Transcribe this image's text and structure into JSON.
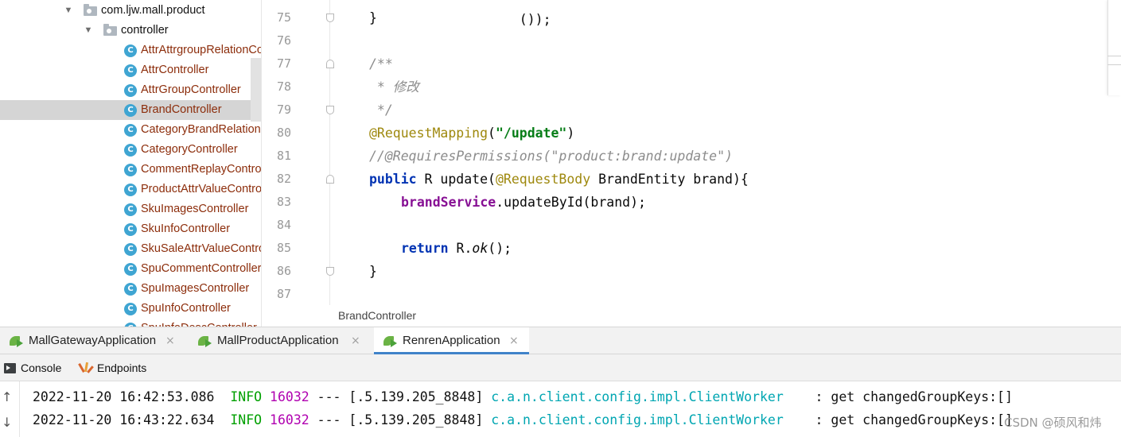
{
  "project_tree": {
    "package": "com.ljw.mall.product",
    "folder": "controller",
    "classes": [
      "AttrAttrgroupRelationController",
      "AttrController",
      "AttrGroupController",
      "BrandController",
      "CategoryBrandRelationController",
      "CategoryController",
      "CommentReplayController",
      "ProductAttrValueController",
      "SkuImagesController",
      "SkuInfoController",
      "SkuSaleAttrValueController",
      "SpuCommentController",
      "SpuImagesController",
      "SpuInfoController",
      "SpuInfoDescController"
    ],
    "selected": "BrandController",
    "icon_letter": "C"
  },
  "editor": {
    "lines": [
      {
        "num": "75",
        "text": "}"
      },
      {
        "num": "76",
        "text": ""
      },
      {
        "num": "77",
        "text": "/**"
      },
      {
        "num": "78",
        "text": " * 修改"
      },
      {
        "num": "79",
        "text": " */"
      },
      {
        "num": "80",
        "annotation": "@RequestMapping",
        "paren_open": "(",
        "string": "\"/update\"",
        "paren_close": ")"
      },
      {
        "num": "81",
        "text": "//@RequiresPermissions(\"product:brand:update\")"
      },
      {
        "num": "82",
        "kw": "public",
        "mid": " R update(",
        "annotation": "@RequestBody",
        "rest": " BrandEntity brand){"
      },
      {
        "num": "83",
        "field": "brandService",
        "rest": ".updateById(brand);"
      },
      {
        "num": "84",
        "text": ""
      },
      {
        "num": "85",
        "kw": "return",
        "mid": " R.",
        "static_call": "ok",
        "rest": "();"
      },
      {
        "num": "86",
        "text": "}"
      },
      {
        "num": "87",
        "text": ""
      }
    ],
    "top_partial": "());",
    "breadcrumb": "BrandController"
  },
  "run_tabs": [
    {
      "label": "MallGatewayApplication",
      "close": "×"
    },
    {
      "label": "MallProductApplication",
      "close": "×"
    },
    {
      "label": "RenrenApplication",
      "close": "×"
    }
  ],
  "console_toolbar": {
    "console_label": "Console",
    "endpoints_label": "Endpoints"
  },
  "console": {
    "up_arrow": "↑",
    "down_arrow": "↓",
    "lines": [
      {
        "ts": "2022-11-20 16:42:53.086",
        "level": "INFO",
        "pid": "16032",
        "sep": "---",
        "thread": "[.5.139.205_8848]",
        "logger": "c.a.n.client.config.impl.ClientWorker",
        "msg": ": get changedGroupKeys:[]"
      },
      {
        "ts": "2022-11-20 16:43:22.634",
        "level": "INFO",
        "pid": "16032",
        "sep": "---",
        "thread": "[.5.139.205_8848]",
        "logger": "c.a.n.client.config.impl.ClientWorker",
        "msg": ": get changedGroupKeys:[]"
      }
    ],
    "watermark": "CSDN @硕风和炜"
  },
  "colors": {
    "annotation": "#9e880d",
    "string": "#067d17",
    "keyword": "#0033b3",
    "field": "#871094",
    "comment": "#8c8c8c",
    "class_text": "#8c2d0b",
    "tab_accent": "#4083c9",
    "log_info": "#00a000",
    "log_pid": "#b000b0",
    "log_logger": "#00a6b2"
  }
}
